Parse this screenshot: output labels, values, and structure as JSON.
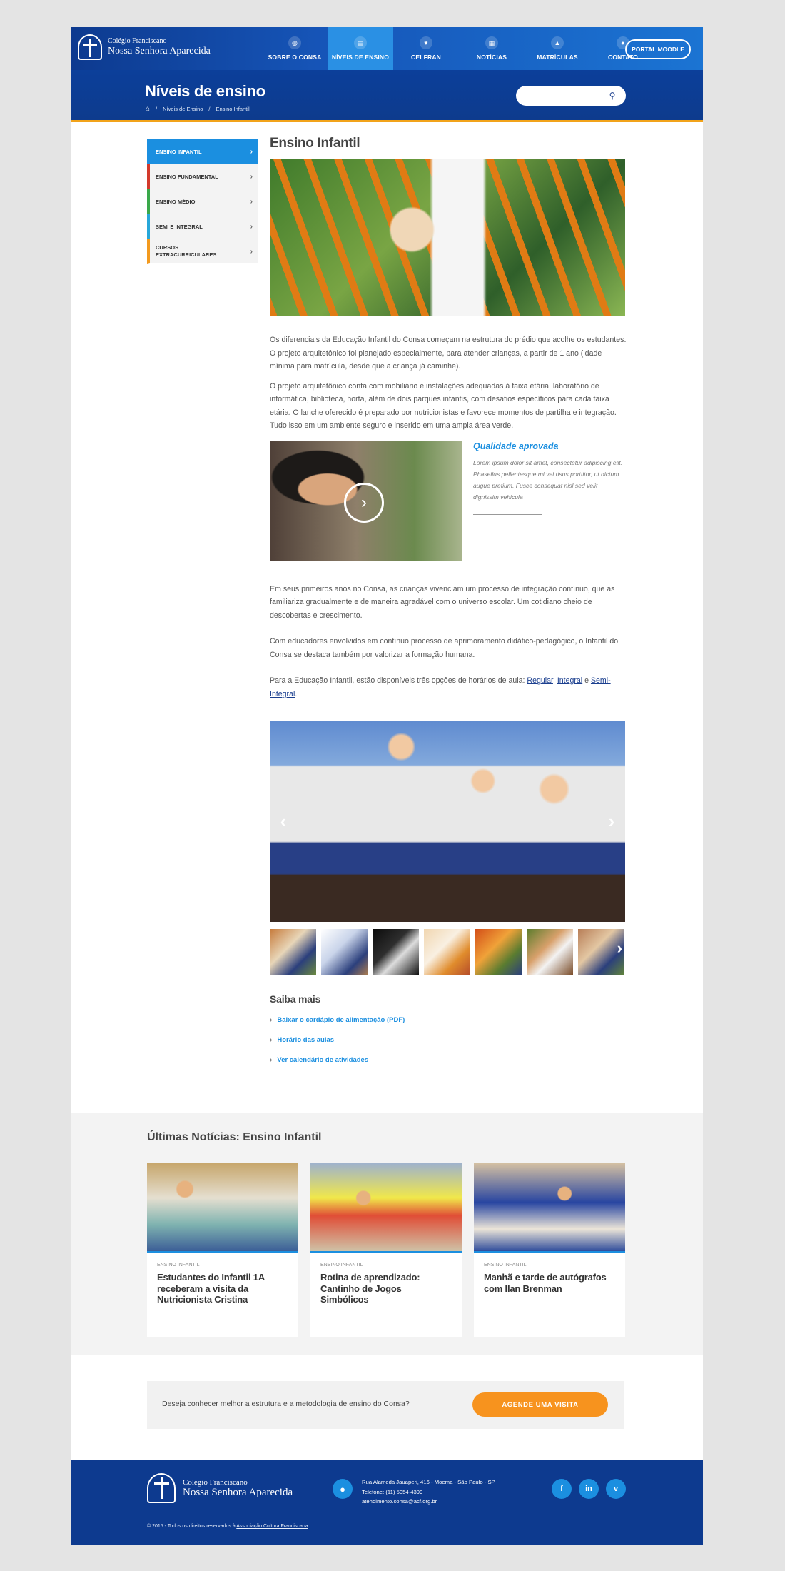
{
  "header": {
    "logo_line1": "Colégio Franciscano",
    "logo_line2": "Nossa Senhora Aparecida",
    "nav": [
      {
        "label": "SOBRE O CONSA",
        "icon": "globe-icon"
      },
      {
        "label": "NÍVEIS DE ENSINO",
        "icon": "book-icon",
        "active": true
      },
      {
        "label": "CELFRAN",
        "icon": "heart-icon"
      },
      {
        "label": "NOTÍCIAS",
        "icon": "newspaper-icon"
      },
      {
        "label": "MATRÍCULAS",
        "icon": "graduation-cap-icon"
      },
      {
        "label": "CONTATO",
        "icon": "chat-icon"
      }
    ],
    "moodle": "PORTAL MOODLE"
  },
  "hero": {
    "title": "Níveis de ensino",
    "breadcrumb": [
      "Níveis de Ensino",
      "Ensino Infantil"
    ],
    "search_placeholder": ""
  },
  "sidebar": {
    "items": [
      {
        "label": "ENSINO INFANTIL",
        "color": "#1b8fe0",
        "active": true
      },
      {
        "label": "ENSINO FUNDAMENTAL",
        "color": "#d33a2c"
      },
      {
        "label": "ENSINO MÉDIO",
        "color": "#3aa84a"
      },
      {
        "label": "SEMI E INTEGRAL",
        "color": "#27a7d9"
      },
      {
        "label": "CURSOS EXTRACURRICULARES",
        "color": "#f39a1e"
      }
    ]
  },
  "main": {
    "title": "Ensino Infantil",
    "p1": "Os diferenciais da Educação Infantil do Consa começam na estrutura do prédio que acolhe os estudantes. O projeto arquitetônico foi planejado especialmente, para atender crianças, a partir de 1 ano (idade mínima para matrícula, desde que a criança já caminhe).",
    "p2": "O projeto arquitetônico conta com mobiliário e instalações adequadas à faixa etária, laboratório de informática, biblioteca, horta, além de dois parques infantis, com desafios específicos para cada faixa etária. O lanche oferecido é preparado por nutricionistas e favorece momentos de partilha e integração. Tudo isso em um ambiente seguro e inserido em uma ampla área verde.",
    "quote_title": "Qualidade aprovada",
    "quote_text": "Lorem ipsum dolor sit amet, consectetur adipiscing elit. Phasellus pellentesque mi vel risus porttitor, ut dictum augue pretium. Fusce consequat nisl sed velit dignissim vehicula",
    "p3": "Em seus primeiros anos no Consa, as crianças vivenciam um processo de integração contínuo, que as familiariza gradualmente e de maneira agradável com o universo escolar. Um cotidiano cheio de descobertas e crescimento.",
    "p4": "Com educadores envolvidos em contínuo processo de aprimoramento didático-pedagógico, o Infantil do Consa se destaca também por valorizar a formação humana.",
    "p5_prefix": "Para a Educação Infantil, estão disponíveis três opções de horários de aula: ",
    "link_regular": "Regular",
    "sep1": ", ",
    "link_integral": "Integral",
    "sep2": " e ",
    "link_semi": "Semi-Integral",
    "p5_suffix": ".",
    "more_title": "Saiba mais",
    "more_links": [
      "Baixar o cardápio de alimentação (PDF)",
      "Horário das aulas",
      "Ver calendário de atividades"
    ]
  },
  "news": {
    "title_bold": "Últimas Notícias:",
    "title_rest": " Ensino Infantil",
    "cards": [
      {
        "category": "ENSINO INFANTIL",
        "title": "Estudantes do Infantil 1A receberam a visita da Nutricionista Cristina"
      },
      {
        "category": "ENSINO INFANTIL",
        "title": "Rotina de aprendizado: Cantinho de Jogos Simbólicos"
      },
      {
        "category": "ENSINO INFANTIL",
        "title": "Manhã e tarde de autógrafos com Ilan Brenman"
      }
    ]
  },
  "cta": {
    "text": "Deseja conhecer melhor a estrutura e a metodologia de ensino do Consa?",
    "button": "AGENDE UMA VISITA"
  },
  "footer": {
    "address": "Rua Alameda Jauaperi, 416 - Moema - São Paulo - SP",
    "phone": "Telefone: (11) 5054-4399",
    "email": "atendimento.consa@acf.org.br",
    "social": [
      "f",
      "in",
      "v"
    ],
    "copyright_prefix": "© 2015 - Todos os direitos reservados à ",
    "copyright_link": "Associação Cultura Franciscana"
  }
}
